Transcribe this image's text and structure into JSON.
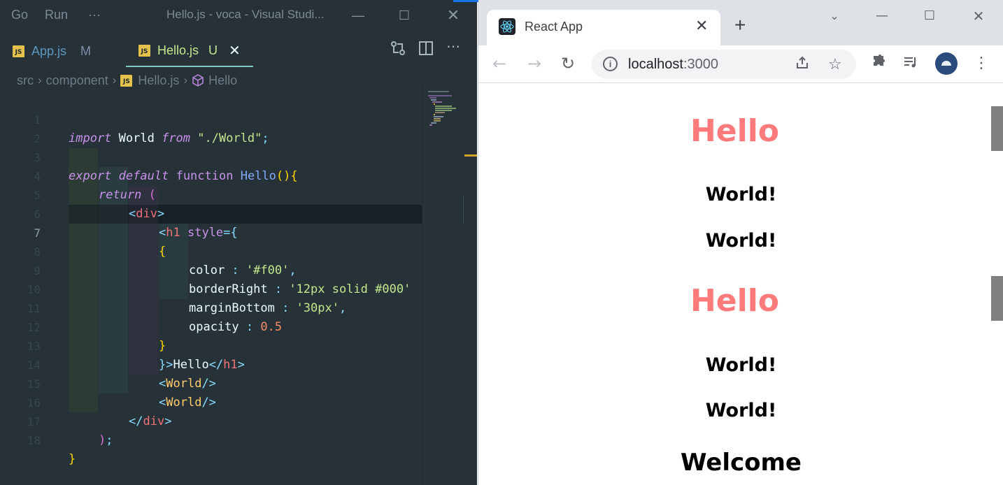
{
  "vscode": {
    "menu": [
      "Go",
      "Run",
      "···"
    ],
    "window_title": "Hello.js - voca - Visual Studi...",
    "tabs": [
      {
        "icon": "JS",
        "name": "App.js",
        "status": "M"
      },
      {
        "icon": "JS",
        "name": "Hello.js",
        "status": "U"
      }
    ],
    "breadcrumb": [
      "src",
      "component",
      "Hello.js",
      "Hello"
    ],
    "line_numbers": [
      "1",
      "2",
      "3",
      "4",
      "5",
      "6",
      "7",
      "8",
      "9",
      "10",
      "11",
      "12",
      "13",
      "14",
      "15",
      "16",
      "17",
      "18"
    ],
    "current_line": "7",
    "code": {
      "l1": [
        "import",
        " World ",
        "from",
        " ",
        "\"./World\"",
        ";"
      ],
      "l3": [
        "export",
        " ",
        "default",
        " ",
        "function",
        " ",
        "Hello",
        "(",
        ")",
        "{"
      ],
      "l4": [
        "return",
        " ",
        "("
      ],
      "l5": [
        "<",
        "div",
        ">"
      ],
      "l6": [
        "<",
        "h1",
        " ",
        "style",
        "=",
        "{"
      ],
      "l7": [
        "{"
      ],
      "l8": [
        "color",
        " : ",
        "'#f00'",
        ","
      ],
      "l9": [
        "borderRight",
        " : ",
        "'12px solid #000'"
      ],
      "l10": [
        "marginBottom",
        " : ",
        "'30px'",
        ","
      ],
      "l11": [
        "opacity",
        " : ",
        "0.5"
      ],
      "l12": [
        "}"
      ],
      "l13": [
        "}",
        ">",
        "Hello",
        "</",
        "h1",
        ">"
      ],
      "l14": [
        "<",
        "World",
        "/>"
      ],
      "l15": [
        "<",
        "World",
        "/>"
      ],
      "l16": [
        "</",
        "div",
        ">"
      ],
      "l17": [
        ")",
        ";"
      ],
      "l18": [
        "}"
      ]
    }
  },
  "chrome": {
    "tab_title": "React App",
    "url_host": "localhost",
    "url_port": ":3000",
    "page": {
      "hello_1": "Hello",
      "world_1": "World!",
      "world_2": "World!",
      "hello_2": "Hello",
      "world_3": "World!",
      "world_4": "World!",
      "welcome": "Welcome"
    }
  },
  "colors": {
    "editor_bg": "#263238",
    "hello_text": "#ff7b7b",
    "tab_accent": "#80cbc4",
    "browser_accent": "#1a73e8"
  }
}
